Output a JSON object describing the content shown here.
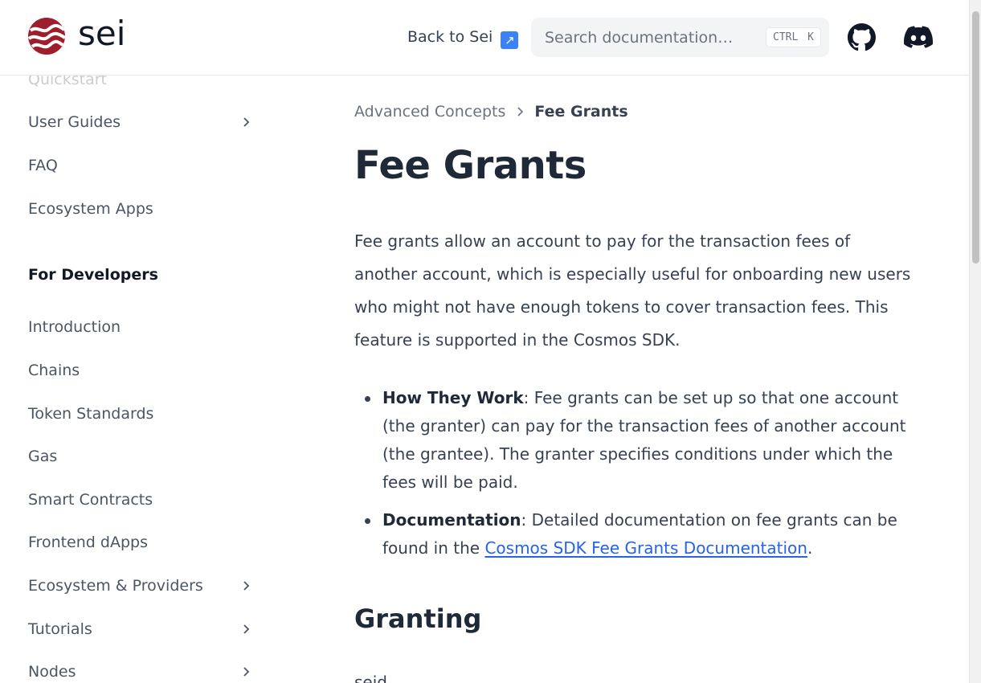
{
  "header": {
    "logo_text": "sei",
    "back_link": "Back to Sei",
    "back_link_arrow": "↗",
    "search_placeholder": "Search documentation…",
    "search_shortcut": "CTRL K",
    "github_icon": "github-icon",
    "discord_icon": "discord-icon"
  },
  "sidebar": {
    "items_top": [
      {
        "label": "Quickstart",
        "expandable": false
      },
      {
        "label": "User Guides",
        "expandable": true
      },
      {
        "label": "FAQ",
        "expandable": false
      },
      {
        "label": "Ecosystem Apps",
        "expandable": false
      }
    ],
    "section_heading": "For Developers",
    "items_dev": [
      {
        "label": "Introduction",
        "expandable": false
      },
      {
        "label": "Chains",
        "expandable": false
      },
      {
        "label": "Token Standards",
        "expandable": false
      },
      {
        "label": "Gas",
        "expandable": false
      },
      {
        "label": "Smart Contracts",
        "expandable": false
      },
      {
        "label": "Frontend dApps",
        "expandable": false
      },
      {
        "label": "Ecosystem & Providers",
        "expandable": true
      },
      {
        "label": "Tutorials",
        "expandable": true
      },
      {
        "label": "Nodes",
        "expandable": true
      }
    ]
  },
  "breadcrumb": {
    "parent": "Advanced Concepts",
    "current": "Fee Grants"
  },
  "main": {
    "title": "Fee Grants",
    "intro": "Fee grants allow an account to pay for the transaction fees of another account, which is especially useful for onboarding new users who might not have enough tokens to cover transaction fees. This feature is supported in the Cosmos SDK.",
    "bullets": [
      {
        "term": "How They Work",
        "text": ": Fee grants can be set up so that one account (the granter) can pay for the transaction fees of another account (the grantee). The granter specifies conditions under which the fees will be paid."
      },
      {
        "term": "Documentation",
        "text": ": Detailed documentation on fee grants can be found in the ",
        "link": "Cosmos SDK Fee Grants Documentation",
        "after": "."
      }
    ],
    "section_heading": "Granting",
    "cut_text": "seid"
  },
  "colors": {
    "brand": "#9e1f2b",
    "link": "#2563eb",
    "text": "#374151"
  }
}
